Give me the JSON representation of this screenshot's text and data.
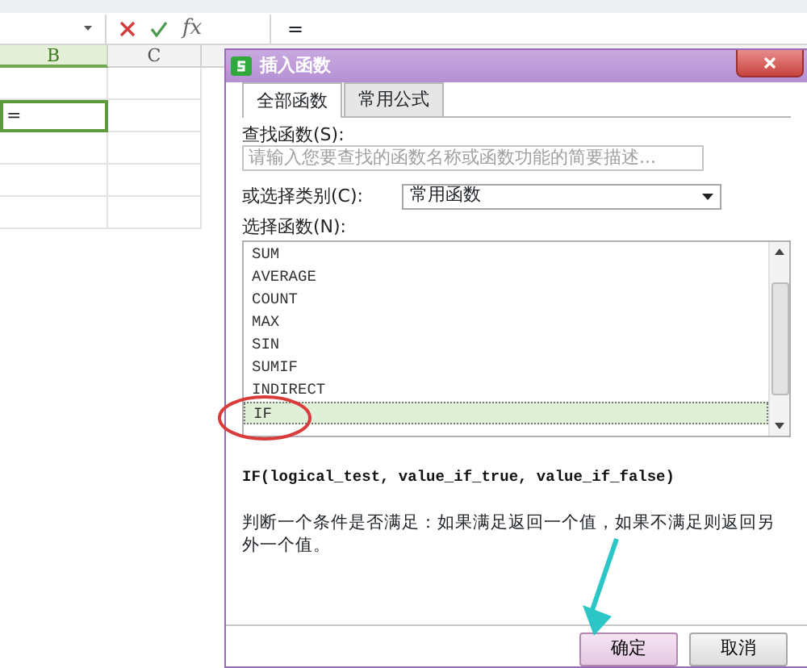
{
  "formula_bar": {
    "fx_label": "fx",
    "formula": "="
  },
  "columns": [
    {
      "label": "B",
      "selected": true
    },
    {
      "label": "C",
      "selected": false
    }
  ],
  "active_cell": {
    "value": "="
  },
  "dialog": {
    "title": "插入函数",
    "tabs": [
      {
        "label": "全部函数",
        "selected": true
      },
      {
        "label": "常用公式",
        "selected": false
      }
    ],
    "search_label": "查找函数(S):",
    "search_placeholder": "请输入您要查找的函数名称或函数功能的简要描述...",
    "category_label": "或选择类别(C):",
    "category": "常用函数",
    "list_label": "选择函数(N):",
    "functions": [
      {
        "name": "SUM",
        "selected": false
      },
      {
        "name": "AVERAGE",
        "selected": false
      },
      {
        "name": "COUNT",
        "selected": false
      },
      {
        "name": "MAX",
        "selected": false
      },
      {
        "name": "SIN",
        "selected": false
      },
      {
        "name": "SUMIF",
        "selected": false
      },
      {
        "name": "INDIRECT",
        "selected": false
      },
      {
        "name": "IF",
        "selected": true
      }
    ],
    "signature": "IF(logical_test, value_if_true, value_if_false)",
    "description": "判断一个条件是否满足：如果满足返回一个值，如果不满足则返回另外一个值。",
    "buttons": [
      {
        "label": "确定",
        "focused": true
      },
      {
        "label": "取消",
        "focused": false
      }
    ]
  }
}
